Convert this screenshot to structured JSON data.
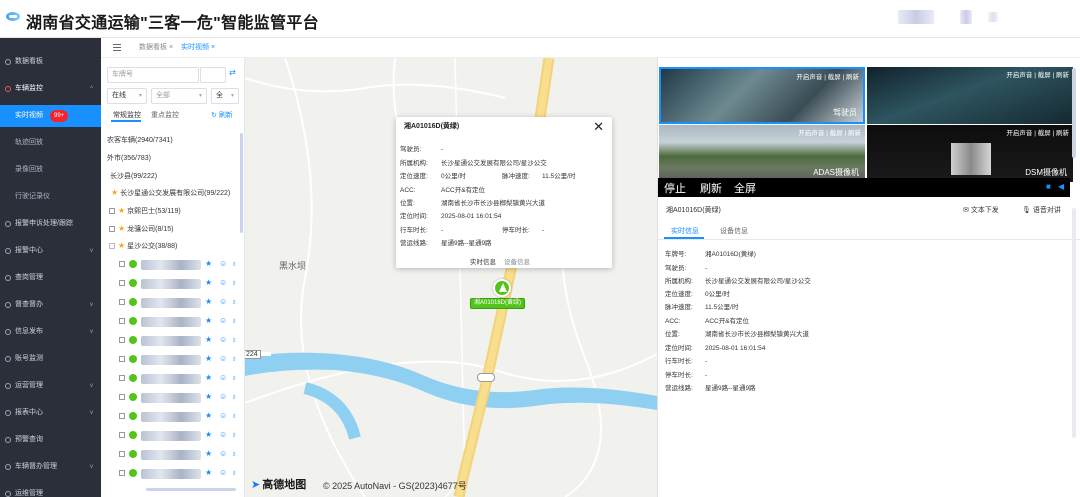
{
  "app": {
    "title": "湖南省交通运输\"三客一危\"智能监管平台"
  },
  "sidebar": {
    "menu": [
      {
        "label": "数据看板"
      },
      {
        "label": "车辆监控",
        "arrow": "^"
      },
      {
        "label": "报警申诉处理/跟踪"
      },
      {
        "label": "报警中心",
        "arrow": "v"
      },
      {
        "label": "查岗管理"
      },
      {
        "label": "督查督办",
        "arrow": "v"
      },
      {
        "label": "信息发布",
        "arrow": "v"
      },
      {
        "label": "账号监测"
      },
      {
        "label": "运营管理",
        "arrow": "v"
      },
      {
        "label": "报表中心",
        "arrow": "v"
      },
      {
        "label": "预警查询"
      },
      {
        "label": "车辆督办管理",
        "arrow": "v"
      },
      {
        "label": "运维管理"
      }
    ],
    "submenu": [
      "实时视频",
      "轨迹回放",
      "录像回放",
      "行驶记录仪"
    ],
    "badge": "99+"
  },
  "tabs": [
    "数据看板",
    "实时视频"
  ],
  "tab_close": "×",
  "filters": {
    "plate_placeholder": "车牌号",
    "status": "在线",
    "all": "全部",
    "all2": "全",
    "dropdown_glyph": "▾",
    "sync_glyph": "⇄"
  },
  "panel_tabs": [
    "常规监控",
    "重点监控"
  ],
  "refresh_label": "刷新",
  "tree": {
    "root": "农客车辆(2940/7341)",
    "n1": "外市(356/783)",
    "n2": "长沙县(99/222)",
    "n3": "长沙星通公交发展有限公司(99/222)",
    "n4": "京熙巴士(53/119)",
    "n5": "龙骧公司(8/15)",
    "n6": "星沙公交(38/88)"
  },
  "map": {
    "place": "黑水坝",
    "road": "224",
    "logo": "高德地图",
    "copyright": "© 2025 AutoNavi - GS(2023)4677号",
    "marker_plate": "湘A01016D(黄绿)"
  },
  "popup": {
    "title": "湘A01016D(黄绿)",
    "close": "✕",
    "rows": [
      {
        "k": "驾驶员:",
        "v": "-"
      },
      {
        "k": "所属机构:",
        "v": "长沙星通公交发展有限公司/星沙公交"
      },
      {
        "k": "定位速度:",
        "v": "0公里/时",
        "k2": "脉冲速度:",
        "v2": "11.5公里/时"
      },
      {
        "k": "ACC:",
        "v": "ACC开&有定位"
      },
      {
        "k": "位置:",
        "v": "湖南省长沙市长沙县榔梨镇黄兴大道"
      },
      {
        "k": "定位时间:",
        "v": "2025-08-01 16:01:54"
      },
      {
        "k": "行车时长:",
        "v": "-",
        "k2": "停车时长:",
        "v2": "-"
      },
      {
        "k": "营运线路:",
        "v": "星通9路--星通9路"
      }
    ],
    "links": [
      "实时信息",
      "设备信息"
    ]
  },
  "cameras": [
    {
      "controls": "开启声音 | 截屏 | 刷新",
      "label": "驾驶员"
    },
    {
      "controls": "开启声音 | 截屏 | 刷新",
      "label": ""
    },
    {
      "controls": "开启声音 | 截屏 | 刷新",
      "label": "ADAS摄像机"
    },
    {
      "controls": "开启声音 | 截屏 | 刷新",
      "label": "DSM摄像机"
    }
  ],
  "video_controls": [
    "停止",
    "刷新",
    "全屏"
  ],
  "details": {
    "plate": "湘A01016D(黄绿)",
    "text_send": "文本下发",
    "voice": "语音对讲",
    "tabs": [
      "实时信息",
      "设备信息"
    ],
    "rows": [
      {
        "k": "车牌号:",
        "v": "湘A01016D(黄绿)"
      },
      {
        "k": "驾驶员:",
        "v": "-"
      },
      {
        "k": "所属机构:",
        "v": "长沙星通公交发展有限公司/星沙公交"
      },
      {
        "k": "定位速度:",
        "v": "0公里/时"
      },
      {
        "k": "脉冲速度:",
        "v": "11.5公里/时"
      },
      {
        "k": "ACC:",
        "v": "ACC开&有定位"
      },
      {
        "k": "位置:",
        "v": "湖南省长沙市长沙县榔梨镇黄兴大道"
      },
      {
        "k": "定位时间:",
        "v": "2025-08-01 16:01:54"
      },
      {
        "k": "行车时长:",
        "v": "-"
      },
      {
        "k": "停车时长:",
        "v": "-"
      },
      {
        "k": "营运线路:",
        "v": "星通9路--星通9路"
      }
    ]
  },
  "colors": {
    "accent": "#1890ff",
    "sidebar": "#2b2f3a",
    "online": "#52c41a",
    "badge": "#f5222d"
  }
}
